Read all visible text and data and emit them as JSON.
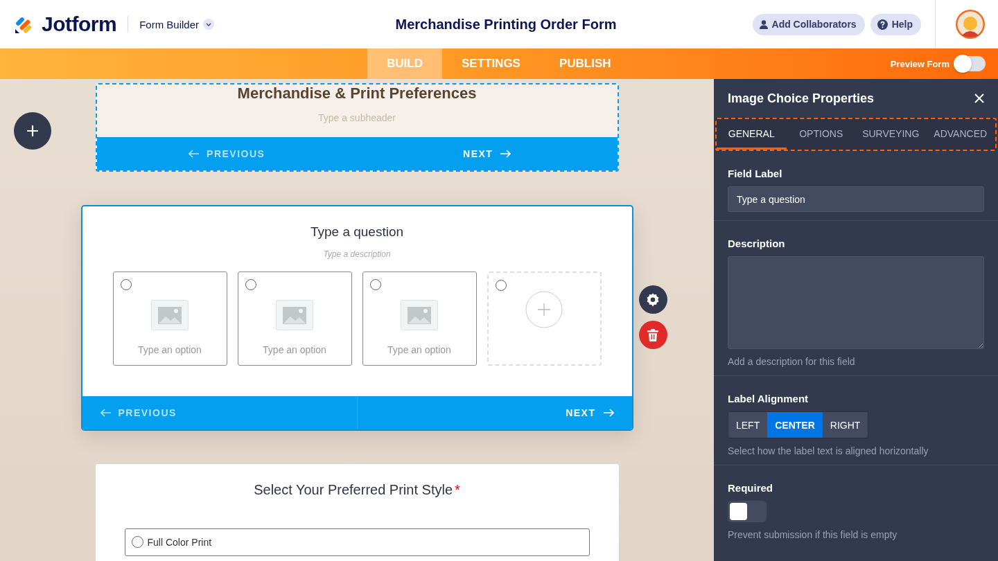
{
  "header": {
    "logo": "Jotform",
    "product": "Form Builder",
    "form_title": "Merchandise Printing Order Form",
    "buttons": [
      {
        "label": "Add Collaborators",
        "kind": "collaborators"
      },
      {
        "label": "Help",
        "kind": "help"
      }
    ]
  },
  "nav": {
    "tabs": [
      {
        "label": "BUILD",
        "selected": true
      },
      {
        "label": "SETTINGS",
        "selected": false
      },
      {
        "label": "PUBLISH",
        "selected": false
      }
    ],
    "preview": {
      "label": "Preview Form",
      "on": false
    }
  },
  "canvas": {
    "header_card": {
      "title": "Merchandise & Print Preferences",
      "subheader": "Type a subheader",
      "pager": [
        {
          "label": "PREVIOUS",
          "kind": "previous",
          "disabled": true
        },
        {
          "label": "NEXT",
          "kind": "next",
          "disabled": false
        }
      ]
    },
    "question_card": {
      "selected": true,
      "question": "Type a question",
      "description": "Type a description",
      "options": [
        {
          "kind": "image",
          "label": "Type an option",
          "selected": false
        },
        {
          "kind": "image",
          "label": "Type an option",
          "selected": false
        },
        {
          "kind": "image",
          "label": "Type an option",
          "selected": false
        },
        {
          "kind": "add",
          "selected": false
        }
      ],
      "pager": [
        {
          "label": "PREVIOUS",
          "kind": "previous",
          "disabled": true
        },
        {
          "label": "NEXT",
          "kind": "next",
          "disabled": false
        }
      ]
    },
    "choice_card": {
      "question": "Select Your Preferred Print Style",
      "required": true,
      "required_mark": "*",
      "options": [
        {
          "label": "Full Color Print",
          "selected": false
        }
      ]
    }
  },
  "panel": {
    "title": "Image Choice Properties",
    "tabs": [
      {
        "label": "GENERAL",
        "selected": true
      },
      {
        "label": "OPTIONS",
        "selected": false
      },
      {
        "label": "SURVEYING",
        "selected": false
      },
      {
        "label": "ADVANCED",
        "selected": false
      }
    ],
    "field_label": {
      "label": "Field Label",
      "value": "Type a question"
    },
    "description": {
      "label": "Description",
      "hint": "Add a description for this field"
    },
    "alignment": {
      "label": "Label Alignment",
      "options": [
        {
          "label": "LEFT",
          "selected": false
        },
        {
          "label": "CENTER",
          "selected": true
        },
        {
          "label": "RIGHT",
          "selected": false
        }
      ],
      "hint": "Select how the label text is aligned horizontally"
    },
    "required": {
      "label": "Required",
      "on": false,
      "hint": "Prevent submission if this field is empty"
    }
  }
}
